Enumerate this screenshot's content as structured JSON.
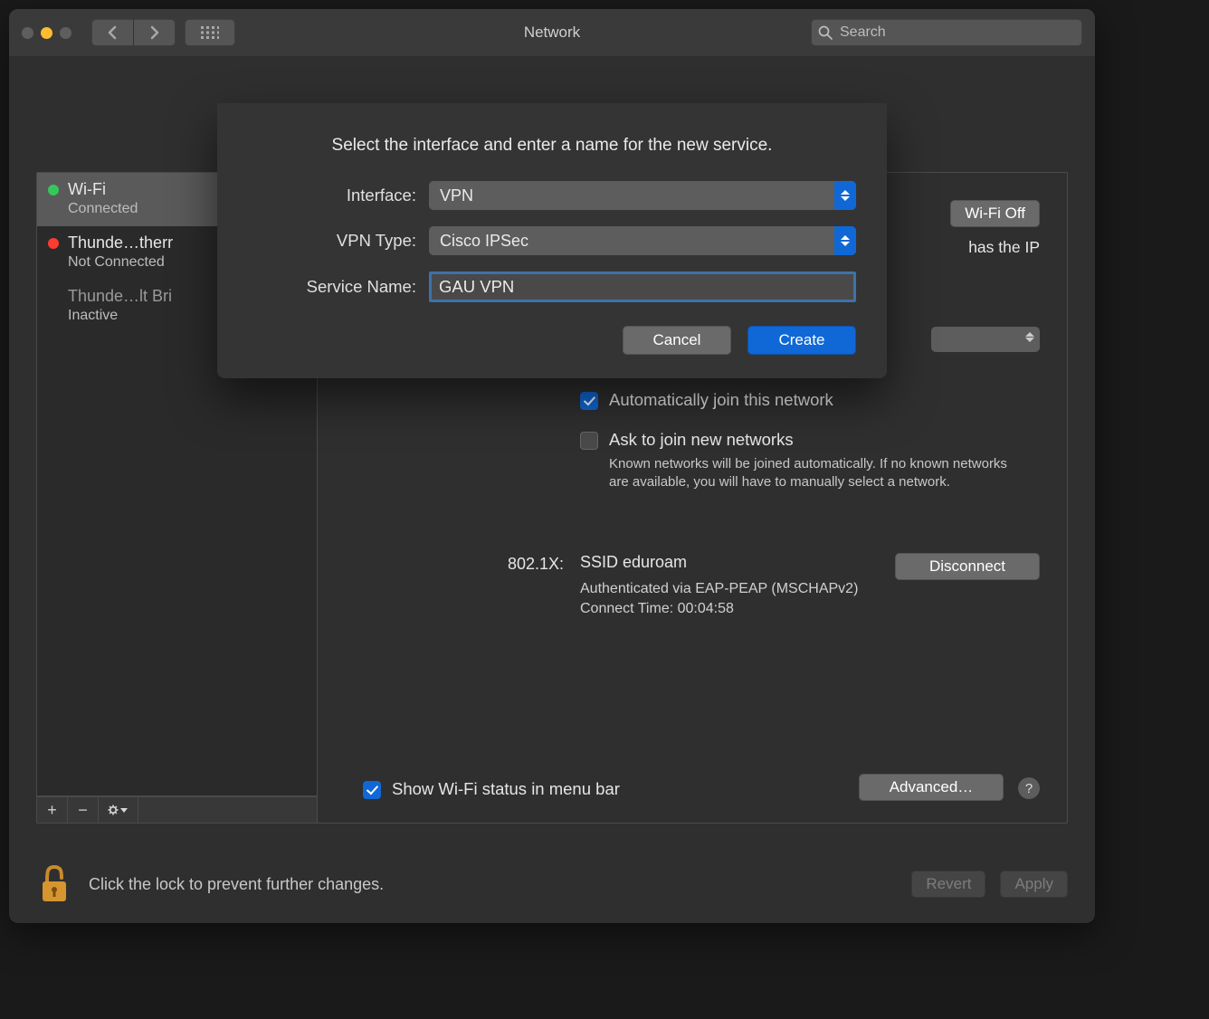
{
  "titlebar": {
    "title": "Network",
    "search_placeholder": "Search"
  },
  "sidebar": {
    "items": [
      {
        "name": "Wi-Fi",
        "status": "Connected"
      },
      {
        "name": "Thunde…therr",
        "status": "Not Connected"
      },
      {
        "name": "Thunde…lt Bri",
        "status": "Inactive"
      }
    ]
  },
  "content": {
    "wifi_off_btn": "Wi-Fi Off",
    "ip_fragment": " has the IP",
    "auto_join": "Automatically join this network",
    "ask_join": "Ask to join new networks",
    "ask_help": "Known networks will be joined automatically. If no known networks are available, you will have to manually select a network.",
    "x8021_label": "802.1X:",
    "ssid": "SSID eduroam",
    "auth_line1": "Authenticated via EAP-PEAP (MSCHAPv2)",
    "auth_line2": "Connect Time: 00:04:58",
    "disconnect": "Disconnect",
    "show_menu": "Show Wi-Fi status in menu bar",
    "advanced": "Advanced…",
    "help": "?"
  },
  "footer": {
    "lock_text": "Click the lock to prevent further changes.",
    "revert": "Revert",
    "apply": "Apply"
  },
  "sheet": {
    "prompt": "Select the interface and enter a name for the new service.",
    "interface_label": "Interface:",
    "interface_value": "VPN",
    "vpntype_label": "VPN Type:",
    "vpntype_value": "Cisco IPSec",
    "servicename_label": "Service Name:",
    "servicename_value": "GAU VPN",
    "cancel": "Cancel",
    "create": "Create"
  }
}
